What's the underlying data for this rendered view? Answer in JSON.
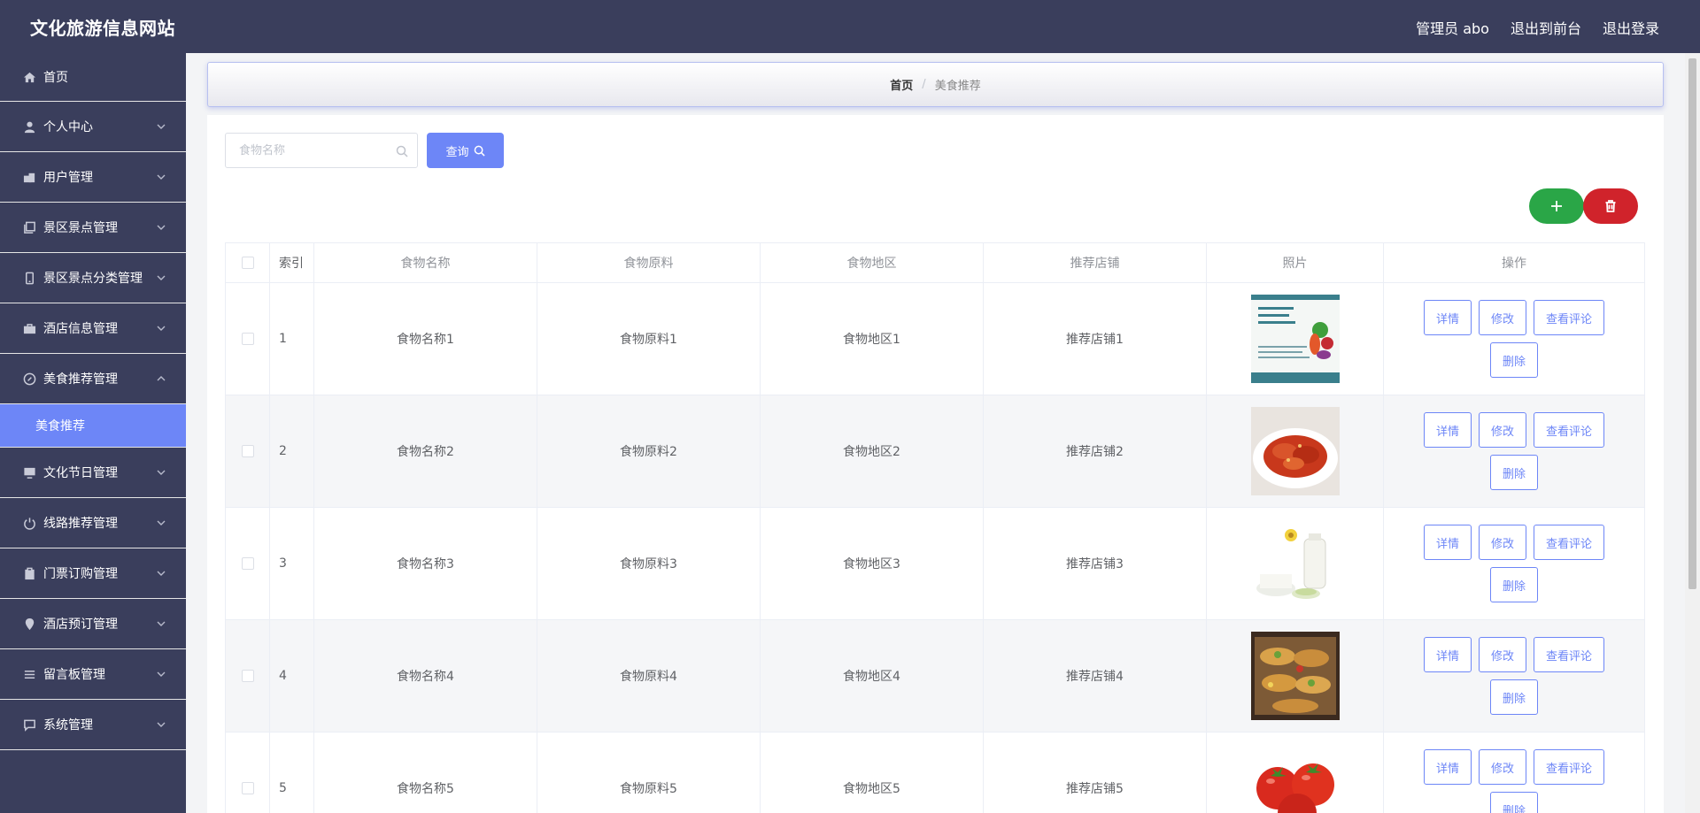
{
  "header": {
    "site_title": "文化旅游信息网站",
    "admin_label": "管理员 abo",
    "to_front": "退出到前台",
    "logout": "退出登录"
  },
  "sidebar": {
    "items": [
      {
        "label": "首页",
        "icon": "home-icon"
      },
      {
        "label": "个人中心",
        "icon": "user-icon"
      },
      {
        "label": "用户管理",
        "icon": "users-icon"
      },
      {
        "label": "景区景点管理",
        "icon": "copy-icon"
      },
      {
        "label": "景区景点分类管理",
        "icon": "phone-icon"
      },
      {
        "label": "酒店信息管理",
        "icon": "briefcase-icon"
      },
      {
        "label": "美食推荐管理",
        "icon": "compass-icon"
      },
      {
        "label": "文化节日管理",
        "icon": "monitor-icon"
      },
      {
        "label": "线路推荐管理",
        "icon": "power-icon"
      },
      {
        "label": "门票订购管理",
        "icon": "clipboard-icon"
      },
      {
        "label": "酒店预订管理",
        "icon": "location-icon"
      },
      {
        "label": "留言板管理",
        "icon": "list-icon"
      },
      {
        "label": "系统管理",
        "icon": "chat-icon"
      }
    ],
    "active_sub": "美食推荐"
  },
  "breadcrumb": {
    "home": "首页",
    "separator": "/",
    "current": "美食推荐"
  },
  "search": {
    "placeholder": "食物名称",
    "value": "",
    "button_label": "查询"
  },
  "table": {
    "headers": {
      "index": "索引",
      "name": "食物名称",
      "ingredients": "食物原料",
      "region": "食物地区",
      "store": "推荐店铺",
      "photo": "照片",
      "actions": "操作"
    },
    "rows": [
      {
        "index": "1",
        "name": "食物名称1",
        "ingredients": "食物原料1",
        "region": "食物地区1",
        "store": "推荐店铺1",
        "photo": "vegetables-poster"
      },
      {
        "index": "2",
        "name": "食物名称2",
        "ingredients": "食物原料2",
        "region": "食物地区2",
        "store": "推荐店铺2",
        "photo": "braised-fish-dish"
      },
      {
        "index": "3",
        "name": "食物名称3",
        "ingredients": "食物原料3",
        "region": "食物地区3",
        "store": "推荐店铺3",
        "photo": "milk-and-cheese"
      },
      {
        "index": "4",
        "name": "食物名称4",
        "ingredients": "食物原料4",
        "region": "食物地区4",
        "store": "推荐店铺4",
        "photo": "tacos-tray"
      },
      {
        "index": "5",
        "name": "食物名称5",
        "ingredients": "食物原料5",
        "region": "食物地区5",
        "store": "推荐店铺5",
        "photo": "tomatoes"
      }
    ],
    "row_actions": {
      "detail": "详情",
      "edit": "修改",
      "comments": "查看评论",
      "delete": "删除"
    }
  },
  "colors": {
    "header_bg": "#3a3e5c",
    "accent": "#6d86f7",
    "add_green": "#2aa647",
    "delete_red": "#d0232b"
  }
}
